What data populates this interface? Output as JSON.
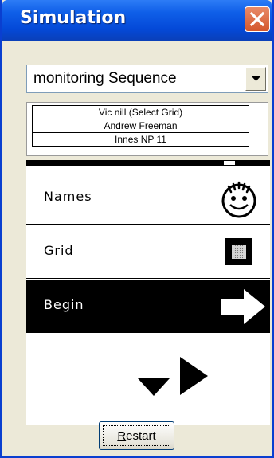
{
  "window": {
    "title": "Simulation"
  },
  "sequence_select": {
    "selected": "monitoring Sequence"
  },
  "participants": [
    "Vic nill (Select Grid)",
    "Andrew Freeman",
    "Innes NP 11"
  ],
  "menu_items": [
    {
      "label": "Names",
      "icon": "smiley-face-icon"
    },
    {
      "label": "Grid",
      "icon": "grid-icon"
    },
    {
      "label": "Begin",
      "icon": "right-arrow-icon",
      "selected": true
    }
  ],
  "navigation": {
    "icons": [
      "down-arrow-icon",
      "right-arrow-icon"
    ]
  },
  "restart_button": {
    "accelerator": "R",
    "label_rest": "estart"
  },
  "colors": {
    "titlebar": "#0449d8",
    "close_button": "#d4572c",
    "window_face": "#ece9d8",
    "selected_item": "#000000"
  }
}
